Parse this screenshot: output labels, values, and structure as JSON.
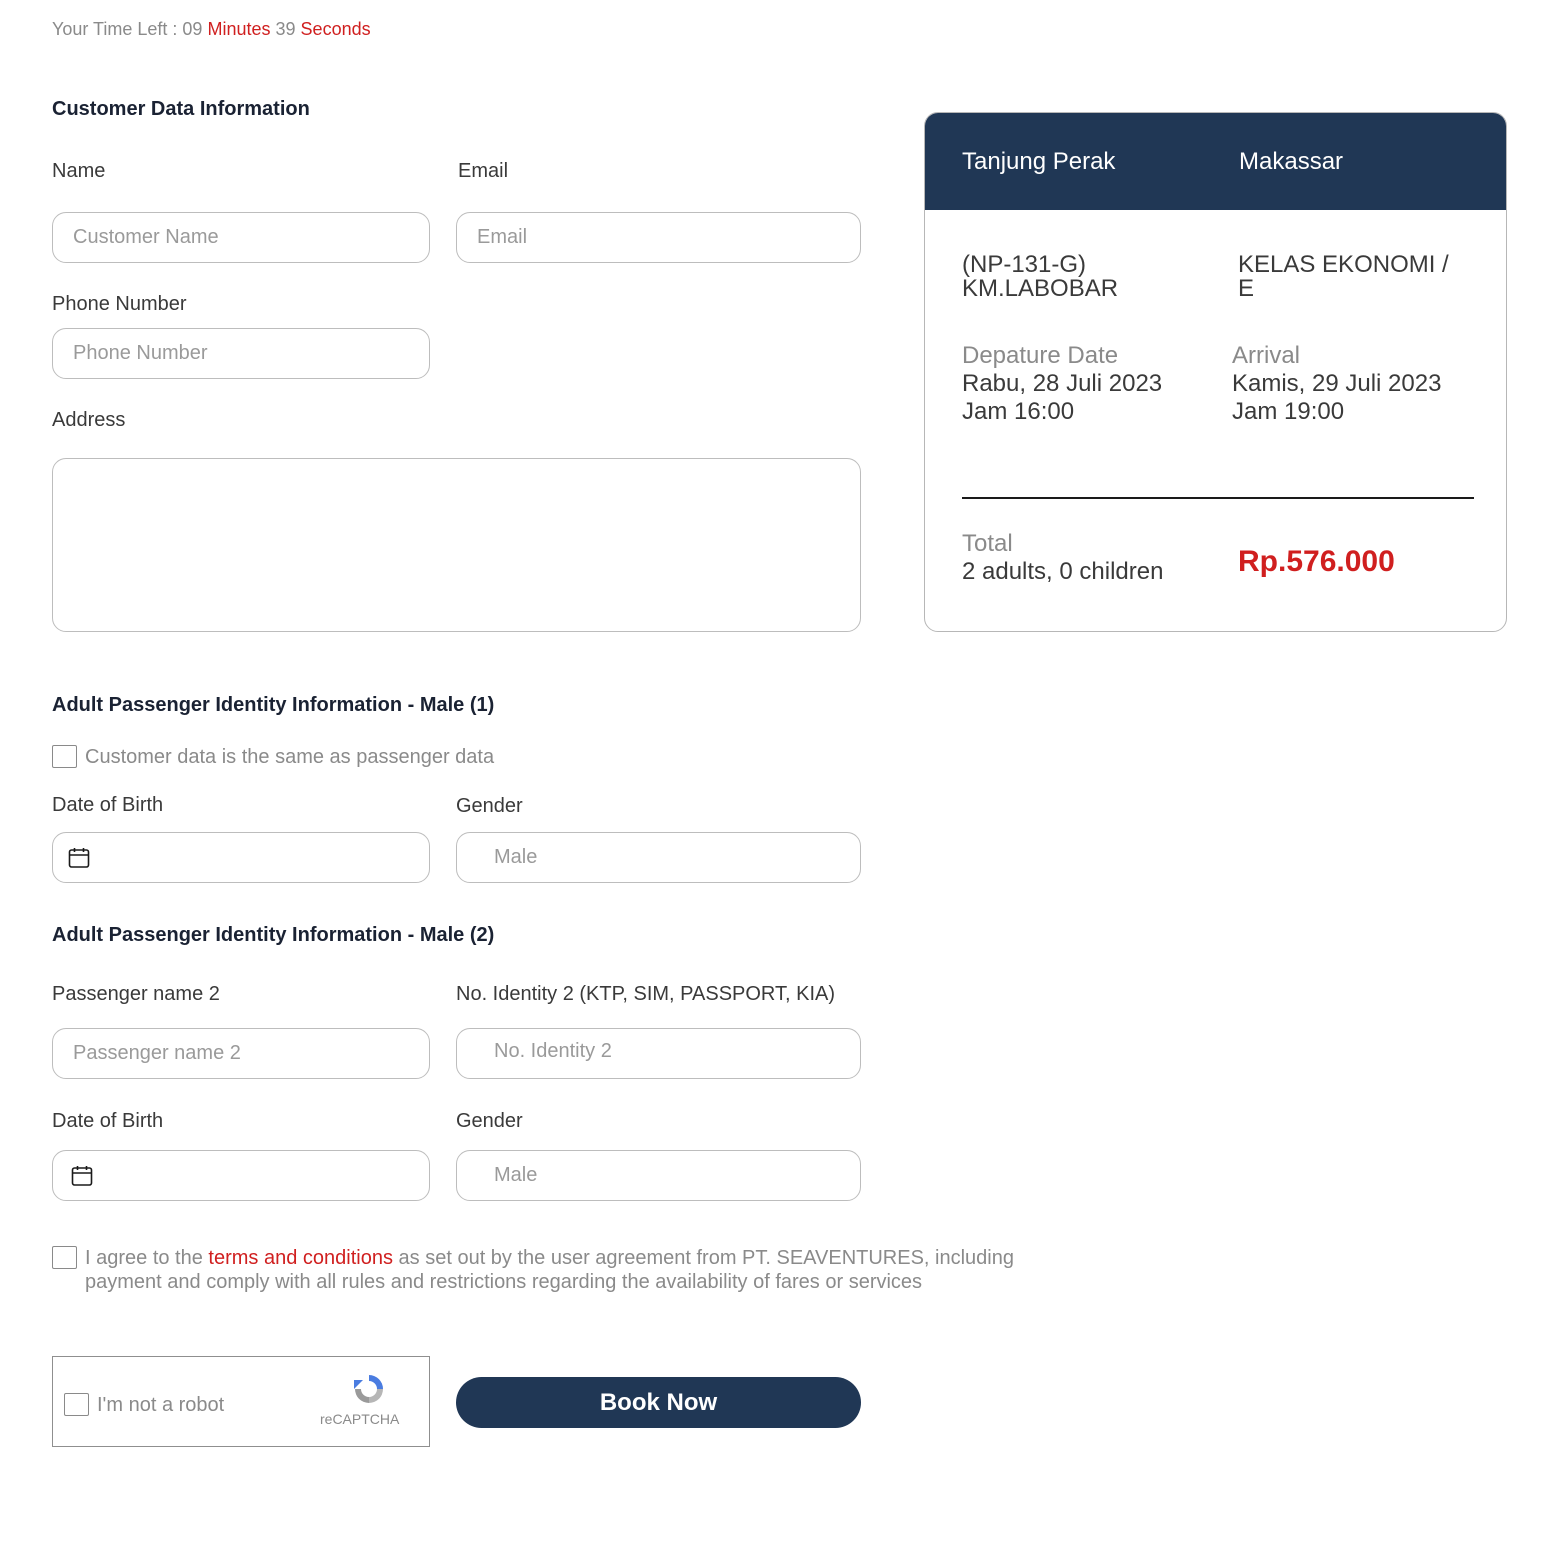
{
  "timer": {
    "prefix": "Your Time Left : ",
    "minutes": "09",
    "minutes_label": "Minutes",
    "seconds": "39",
    "seconds_label": "Seconds"
  },
  "customer": {
    "title": "Customer Data Information",
    "name_label": "Name",
    "name_placeholder": "Customer Name",
    "email_label": "Email",
    "email_placeholder": "Email",
    "phone_label": "Phone Number",
    "phone_placeholder": "Phone Number",
    "address_label": "Address"
  },
  "summary": {
    "origin": "Tanjung Perak",
    "destination": "Makassar",
    "ship_line1": "(NP-131-G)",
    "ship_line2": "KM.LABOBAR",
    "class_line1": "KELAS EKONOMI /",
    "class_line2": "E",
    "departure_label": "Depature Date",
    "departure_date": "Rabu, 28 Juli 2023",
    "departure_time": "Jam 16:00",
    "arrival_label": "Arrival",
    "arrival_date": "Kamis, 29 Juli 2023",
    "arrival_time": "Jam 19:00",
    "total_label": "Total",
    "passengers": "2 adults, 0 children",
    "price": "Rp.576.000",
    "header_color": "#203755",
    "price_color": "#d01f1f"
  },
  "passenger1": {
    "title": "Adult Passenger Identity Information - Male (1)",
    "same_as_customer": "Customer data is the same as passenger data",
    "dob_label": "Date of Birth",
    "gender_label": "Gender",
    "gender_value": "Male"
  },
  "passenger2": {
    "title": "Adult Passenger Identity Information - Male (2)",
    "name_label": "Passenger name 2",
    "name_placeholder": "Passenger name 2",
    "identity_label": "No. Identity 2 (KTP, SIM, PASSPORT, KIA)",
    "identity_placeholder": "No. Identity 2",
    "dob_label": "Date of Birth",
    "gender_label": "Gender",
    "gender_value": "Male"
  },
  "agreement": {
    "prefix": "I agree to the ",
    "link": "terms and conditions",
    "suffix": " as set out by the user agreement from PT. SEAVENTURES, including payment and comply with all rules and restrictions regarding the availability of fares or services"
  },
  "captcha": {
    "label": "I'm not a robot",
    "brand": "reCAPTCHA"
  },
  "book_button": "Book Now",
  "icons": {
    "calendar": "calendar-icon",
    "recaptcha": "recaptcha-logo-icon"
  }
}
